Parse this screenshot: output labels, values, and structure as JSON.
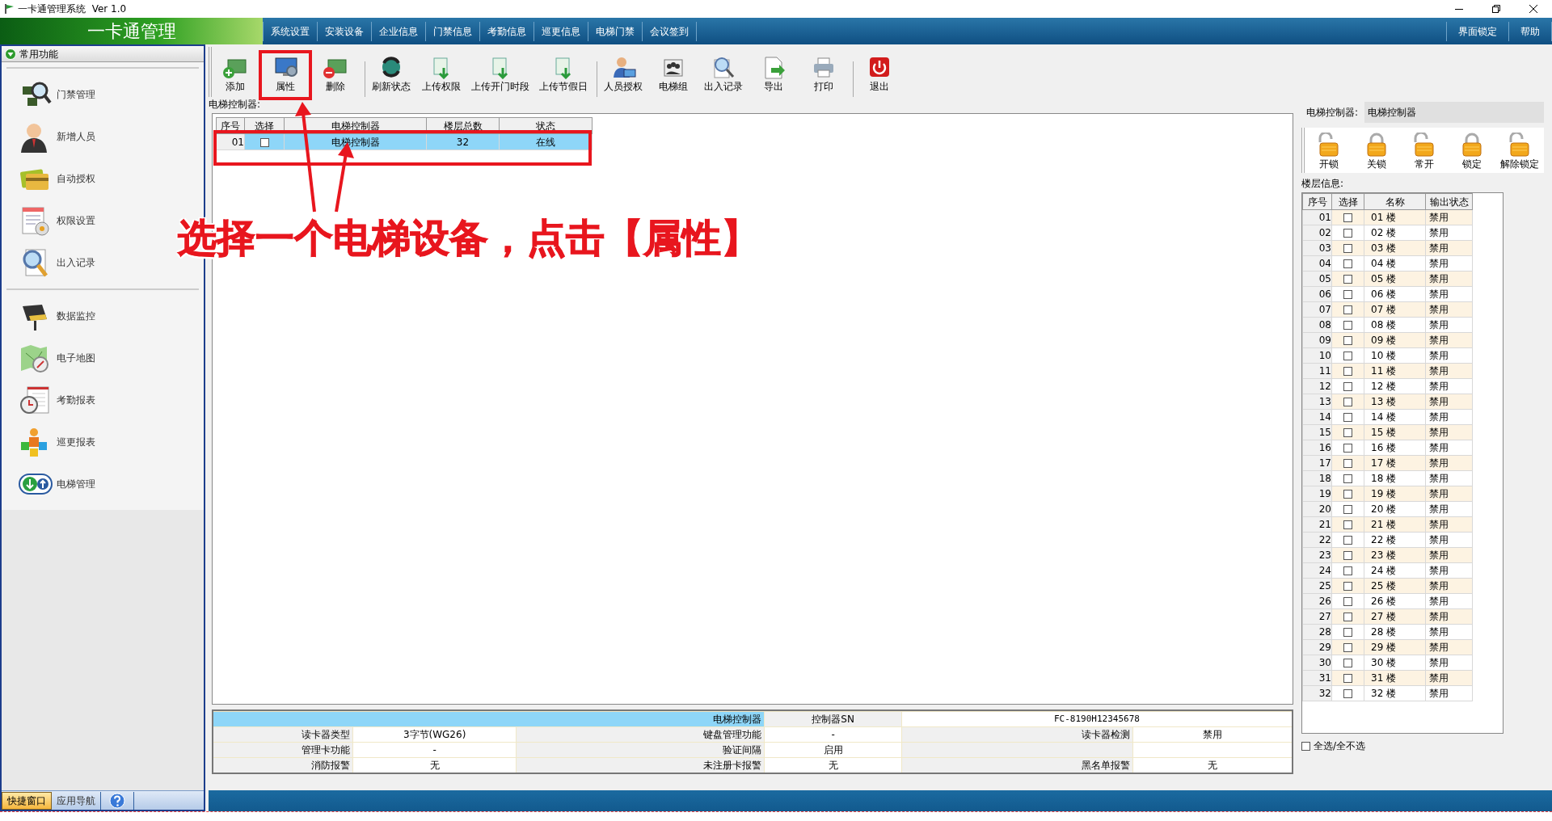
{
  "window": {
    "title": "一卡通管理系统  Ver 1.0"
  },
  "logo": "一卡通管理",
  "menu": [
    {
      "label": "系统设置"
    },
    {
      "label": "安装设备"
    },
    {
      "label": "企业信息"
    },
    {
      "label": "门禁信息"
    },
    {
      "label": "考勤信息"
    },
    {
      "label": "巡更信息"
    },
    {
      "label": "电梯门禁"
    },
    {
      "label": "会议签到"
    }
  ],
  "menu_right": [
    {
      "label": "界面锁定"
    },
    {
      "label": "帮助"
    }
  ],
  "sidebar": {
    "header": "常用功能",
    "groups": [
      [
        {
          "label": "门禁管理"
        },
        {
          "label": "新增人员"
        },
        {
          "label": "自动授权"
        },
        {
          "label": "权限设置"
        },
        {
          "label": "出入记录"
        }
      ],
      [
        {
          "label": "数据监控"
        },
        {
          "label": "电子地图"
        },
        {
          "label": "考勤报表"
        },
        {
          "label": "巡更报表"
        },
        {
          "label": "电梯管理"
        }
      ]
    ],
    "tabs": [
      {
        "label": "快捷窗口",
        "selected": true
      },
      {
        "label": "应用导航",
        "selected": false
      }
    ]
  },
  "toolbar": [
    {
      "label": "添加"
    },
    {
      "label": "属性"
    },
    {
      "label": "删除"
    },
    {
      "label": "刷新状态"
    },
    {
      "label": "上传权限"
    },
    {
      "label": "上传开门时段"
    },
    {
      "label": "上传节假日"
    },
    {
      "label": "人员授权"
    },
    {
      "label": "电梯组"
    },
    {
      "label": "出入记录"
    },
    {
      "label": "导出"
    },
    {
      "label": "打印"
    },
    {
      "label": "退出"
    }
  ],
  "controllers": {
    "label": "电梯控制器:",
    "columns": [
      "序号",
      "选择",
      "电梯控制器",
      "楼层总数",
      "状态"
    ],
    "rows": [
      {
        "no": "01",
        "checked": false,
        "name": "电梯控制器",
        "floors": "32",
        "status": "在线",
        "selected": true
      }
    ]
  },
  "detail": {
    "title": "电梯控制器",
    "sn_label": "控制器SN",
    "sn": "FC-8190H12345678",
    "rows": [
      [
        {
          "label": "读卡器类型",
          "value": "3字节(WG26)"
        },
        {
          "label": "键盘管理功能",
          "value": "-"
        },
        {
          "label": "读卡器检测",
          "value": "禁用"
        }
      ],
      [
        {
          "label": "管理卡功能",
          "value": "-"
        },
        {
          "label": "验证间隔",
          "value": "启用"
        }
      ],
      [
        {
          "label": "消防报警",
          "value": "无"
        },
        {
          "label": "未注册卡报警",
          "value": "无"
        },
        {
          "label": "黑名单报警",
          "value": "无"
        }
      ]
    ]
  },
  "right": {
    "controller_label": "电梯控制器:",
    "controller_value": "电梯控制器",
    "locks": [
      {
        "label": "开锁",
        "locked": false
      },
      {
        "label": "关锁",
        "locked": true
      },
      {
        "label": "常开",
        "locked": false
      },
      {
        "label": "锁定",
        "locked": true
      },
      {
        "label": "解除锁定",
        "locked": false
      }
    ],
    "floors_label": "楼层信息:",
    "columns": [
      "序号",
      "选择",
      "名称",
      "输出状态"
    ],
    "floors": [
      {
        "no": "01",
        "checked": false,
        "name": "01 楼",
        "output": "禁用"
      },
      {
        "no": "02",
        "checked": false,
        "name": "02 楼",
        "output": "禁用"
      },
      {
        "no": "03",
        "checked": false,
        "name": "03 楼",
        "output": "禁用"
      },
      {
        "no": "04",
        "checked": false,
        "name": "04 楼",
        "output": "禁用"
      },
      {
        "no": "05",
        "checked": false,
        "name": "05 楼",
        "output": "禁用"
      },
      {
        "no": "06",
        "checked": false,
        "name": "06 楼",
        "output": "禁用"
      },
      {
        "no": "07",
        "checked": false,
        "name": "07 楼",
        "output": "禁用"
      },
      {
        "no": "08",
        "checked": false,
        "name": "08 楼",
        "output": "禁用"
      },
      {
        "no": "09",
        "checked": false,
        "name": "09 楼",
        "output": "禁用"
      },
      {
        "no": "10",
        "checked": false,
        "name": "10 楼",
        "output": "禁用"
      },
      {
        "no": "11",
        "checked": false,
        "name": "11 楼",
        "output": "禁用"
      },
      {
        "no": "12",
        "checked": false,
        "name": "12 楼",
        "output": "禁用"
      },
      {
        "no": "13",
        "checked": false,
        "name": "13 楼",
        "output": "禁用"
      },
      {
        "no": "14",
        "checked": false,
        "name": "14 楼",
        "output": "禁用"
      },
      {
        "no": "15",
        "checked": false,
        "name": "15 楼",
        "output": "禁用"
      },
      {
        "no": "16",
        "checked": false,
        "name": "16 楼",
        "output": "禁用"
      },
      {
        "no": "17",
        "checked": false,
        "name": "17 楼",
        "output": "禁用"
      },
      {
        "no": "18",
        "checked": false,
        "name": "18 楼",
        "output": "禁用"
      },
      {
        "no": "19",
        "checked": false,
        "name": "19 楼",
        "output": "禁用"
      },
      {
        "no": "20",
        "checked": false,
        "name": "20 楼",
        "output": "禁用"
      },
      {
        "no": "21",
        "checked": false,
        "name": "21 楼",
        "output": "禁用"
      },
      {
        "no": "22",
        "checked": false,
        "name": "22 楼",
        "output": "禁用"
      },
      {
        "no": "23",
        "checked": false,
        "name": "23 楼",
        "output": "禁用"
      },
      {
        "no": "24",
        "checked": false,
        "name": "24 楼",
        "output": "禁用"
      },
      {
        "no": "25",
        "checked": false,
        "name": "25 楼",
        "output": "禁用"
      },
      {
        "no": "26",
        "checked": false,
        "name": "26 楼",
        "output": "禁用"
      },
      {
        "no": "27",
        "checked": false,
        "name": "27 楼",
        "output": "禁用"
      },
      {
        "no": "28",
        "checked": false,
        "name": "28 楼",
        "output": "禁用"
      },
      {
        "no": "29",
        "checked": false,
        "name": "29 楼",
        "output": "禁用"
      },
      {
        "no": "30",
        "checked": false,
        "name": "30 楼",
        "output": "禁用"
      },
      {
        "no": "31",
        "checked": false,
        "name": "31 楼",
        "output": "禁用"
      },
      {
        "no": "32",
        "checked": false,
        "name": "32 楼",
        "output": "禁用"
      }
    ],
    "select_all": {
      "label": "全选/全不选",
      "checked": false
    }
  },
  "annotation": {
    "text": "选择一个电梯设备，点击【属性】"
  }
}
